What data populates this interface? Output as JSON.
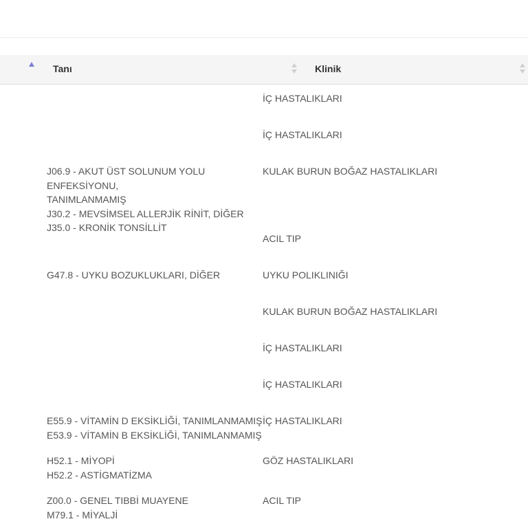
{
  "table": {
    "headers": {
      "diagnosis": "Tanı",
      "clinic": "Klinik"
    },
    "rows": [
      {
        "diagnoses": [],
        "clinic": "İÇ HASTALIKLARI"
      },
      {
        "diagnoses": [],
        "clinic": "İÇ HASTALIKLARI"
      },
      {
        "diagnoses": [
          "J06.9 - AKUT ÜST SOLUNUM YOLU ENFEKSİYONU,\nTANIMLANMAMIŞ",
          "J30.2 - MEVSİMSEL ALLERJİK RİNİT, DİĞER",
          "J35.0 - KRONİK TONSİLLİT"
        ],
        "clinic": "KULAK BURUN BOĞAZ HASTALIKLARI"
      },
      {
        "diagnoses": [],
        "clinic": "ACIL TIP"
      },
      {
        "diagnoses": [
          "G47.8 - UYKU BOZUKLUKLARI, DİĞER"
        ],
        "clinic": "UYKU POLIKLINIĞI"
      },
      {
        "diagnoses": [],
        "clinic": "KULAK BURUN BOĞAZ HASTALIKLARI"
      },
      {
        "diagnoses": [],
        "clinic": "İÇ HASTALIKLARI"
      },
      {
        "diagnoses": [],
        "clinic": "İÇ HASTALIKLARI"
      },
      {
        "diagnoses": [
          "E55.9 - VİTAMİN D EKSİKLİĞİ, TANIMLANMAMIŞ",
          "E53.9 - VİTAMİN B EKSİKLİĞİ, TANIMLANMAMIŞ"
        ],
        "clinic": "İÇ HASTALIKLARI"
      },
      {
        "diagnoses": [
          "H52.1 - MİYOPİ",
          "H52.2 - ASTİGMATİZMA"
        ],
        "clinic": "GÖZ HASTALIKLARI"
      },
      {
        "diagnoses": [
          "Z00.0 - GENEL TIBBİ MUAYENE",
          "M79.1 - MİYALJİ"
        ],
        "clinic": "ACIL TIP"
      }
    ]
  }
}
